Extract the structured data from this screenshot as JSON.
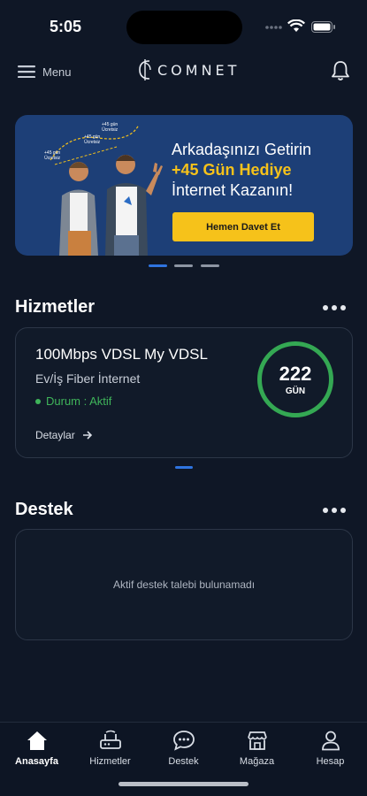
{
  "status_bar": {
    "time": "5:05"
  },
  "header": {
    "menu_label": "Menu",
    "logo_text": "COMNET"
  },
  "banner": {
    "line1": "Arkadaşınızı Getirin",
    "line2": "+45 Gün Hediye",
    "line3": "İnternet Kazanın!",
    "cta": "Hemen Davet Et",
    "bubbles": [
      "+45 gün\nÜcretsiz",
      "+45 gün\nÜcretsiz",
      "+45 gün\nÜcretsiz"
    ],
    "colors": {
      "background": "#1d3f77",
      "accent": "#f6c21a"
    }
  },
  "carousel": {
    "slides": 3,
    "active": 1
  },
  "services": {
    "title": "Hizmetler",
    "card": {
      "name": "100Mbps VDSL My VDSL",
      "type": "Ev/İş Fiber İnternet",
      "status": "Durum : Aktif",
      "details_label": "Detaylar",
      "days": "222",
      "days_unit": "GÜN"
    }
  },
  "support": {
    "title": "Destek",
    "empty_text": "Aktif destek talebi bulunamadı"
  },
  "tabbar": {
    "tabs": [
      {
        "label": "Anasayfa",
        "icon": "home-icon",
        "active": true
      },
      {
        "label": "Hizmetler",
        "icon": "router-icon",
        "active": false
      },
      {
        "label": "Destek",
        "icon": "chat-icon",
        "active": false
      },
      {
        "label": "Mağaza",
        "icon": "store-icon",
        "active": false
      },
      {
        "label": "Hesap",
        "icon": "user-icon",
        "active": false
      }
    ]
  }
}
